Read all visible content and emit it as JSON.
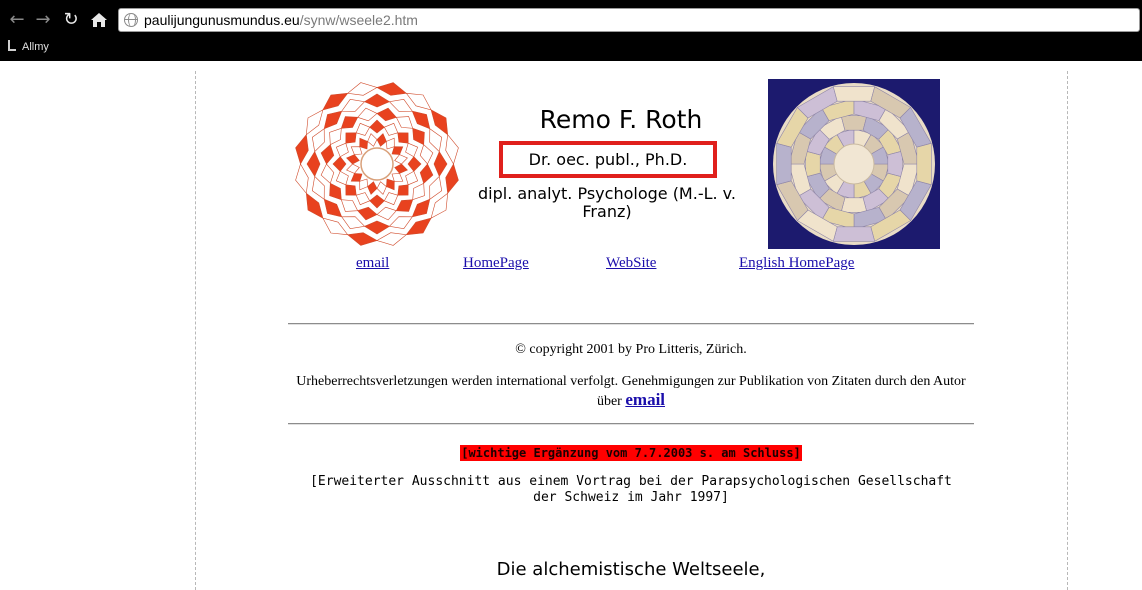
{
  "browser": {
    "url_host": "paulijungunusmundus.eu",
    "url_path": "/synw/wseele2.htm",
    "bookmark": "Allmy"
  },
  "header": {
    "name": "Remo F. Roth",
    "degree": "Dr. oec. publ., Ph.D.",
    "subtitle": "dipl. analyt. Psychologe (M.-L. v. Franz)"
  },
  "links": {
    "email": "email",
    "homepage": "HomePage",
    "website": "WebSite",
    "english_homepage": "English HomePage"
  },
  "copyright": "© copyright 2001 by Pro Litteris, Zürich.",
  "notice": {
    "text": "Urheberrechtsverletzungen werden international verfolgt. Genehmigungen zur Publikation von Zitaten durch den Autor über",
    "link": "email"
  },
  "highlight": "[wichtige Ergänzung vom 7.7.2003 s. am Schluss]",
  "excerpt": "[Erweiterter Ausschnitt aus einem Vortrag bei der Parapsychologischen Gesellschaft der Schweiz im Jahr 1997]",
  "heading": "Die alchemistische Weltseele,",
  "colors": {
    "highlight_red": "#ff0000",
    "box_red": "#e0201c",
    "link_blue": "#1a0dab",
    "mandala_red": "#e8421f",
    "mandala_navy": "#1c1a6e"
  }
}
